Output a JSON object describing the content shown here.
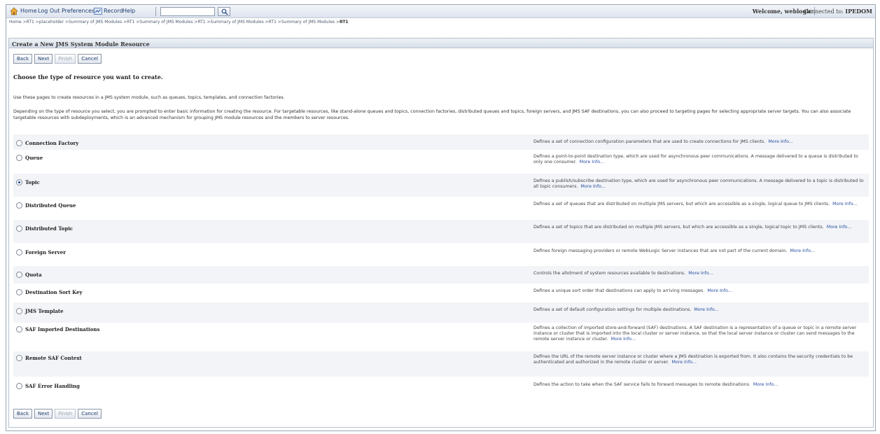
{
  "topbar": {
    "links": [
      "Home",
      "Log Out",
      "Preferences",
      "Record",
      "Help"
    ],
    "search_placeholder": "",
    "welcome": "Welcome, weblogic",
    "connected_label": "Connected to:",
    "connected_value": "IPEDOM"
  },
  "breadcrumb": {
    "trail": "Home >RT1 >placeholder >Summary of JMS Modules >RT1 >Summary of JMS Modules >RT1 >Summary of JMS Modules >RT1 >Summary of JMS Modules >",
    "current": "RT1"
  },
  "panel": {
    "title": "Create a New JMS System Module Resource",
    "buttons": {
      "back": "Back",
      "next": "Next",
      "finish": "Finish",
      "cancel": "Cancel"
    },
    "heading": "Choose the type of resource you want to create.",
    "intro": "Use these pages to create resources in a JMS system module, such as queues, topics, templates, and connection factories.",
    "detail": "Depending on the type of resource you select, you are prompted to enter basic information for creating the resource. For targetable resources, like stand-alone queues and topics, connection factories, distributed queues and topics, foreign servers, and JMS SAF destinations, you can also proceed to targeting pages for selecting appropriate server targets. You can also associate targetable resources with subdeployments, which is an advanced mechanism for grouping JMS module resources and the members to server resources.",
    "more_info": "More Info...",
    "options": [
      {
        "label": "Connection Factory",
        "checked": false,
        "desc": "Defines a set of connection configuration parameters that are used to create connections for JMS clients."
      },
      {
        "label": "Queue",
        "checked": false,
        "desc": "Defines a point-to-point destination type, which are used for asynchronous peer communications. A message delivered to a queue is distributed to only one consumer."
      },
      {
        "label": "Topic",
        "checked": true,
        "desc": "Defines a publish/subscribe destination type, which are used for asynchronous peer communications. A message delivered to a topic is distributed to all topic consumers."
      },
      {
        "label": "Distributed Queue",
        "checked": false,
        "desc": "Defines a set of queues that are distributed on multiple JMS servers, but which are accessible as a single, logical queue to JMS clients."
      },
      {
        "label": "Distributed Topic",
        "checked": false,
        "desc": "Defines a set of topics that are distributed on multiple JMS servers, but which are accessible as a single, logical topic to JMS clients."
      },
      {
        "label": "Foreign Server",
        "checked": false,
        "desc": "Defines foreign messaging providers or remote WebLogic Server instances that are not part of the current domain."
      },
      {
        "label": "Quota",
        "checked": false,
        "desc": "Controls the allotment of system resources available to destinations."
      },
      {
        "label": "Destination Sort Key",
        "checked": false,
        "desc": "Defines a unique sort order that destinations can apply to arriving messages."
      },
      {
        "label": "JMS Template",
        "checked": false,
        "desc": "Defines a set of default configuration settings for multiple destinations."
      },
      {
        "label": "SAF Imported Destinations",
        "checked": false,
        "desc": "Defines a collection of imported store-and-forward (SAF) destinations. A SAF destination is a representation of a queue or topic in a remote server instance or cluster that is imported into the local cluster or server instance, so that the local server instance or cluster can send messages to the remote server instance or cluster."
      },
      {
        "label": "Remote SAF Context",
        "checked": false,
        "desc": "Defines the URL of the remote server instance or cluster where a JMS destination is exported from. It also contains the security credentials to be authenticated and authorized in the remote cluster or server."
      },
      {
        "label": "SAF Error Handling",
        "checked": false,
        "desc": "Defines the action to take when the SAF service fails to forward messages to remote destinations."
      }
    ]
  }
}
